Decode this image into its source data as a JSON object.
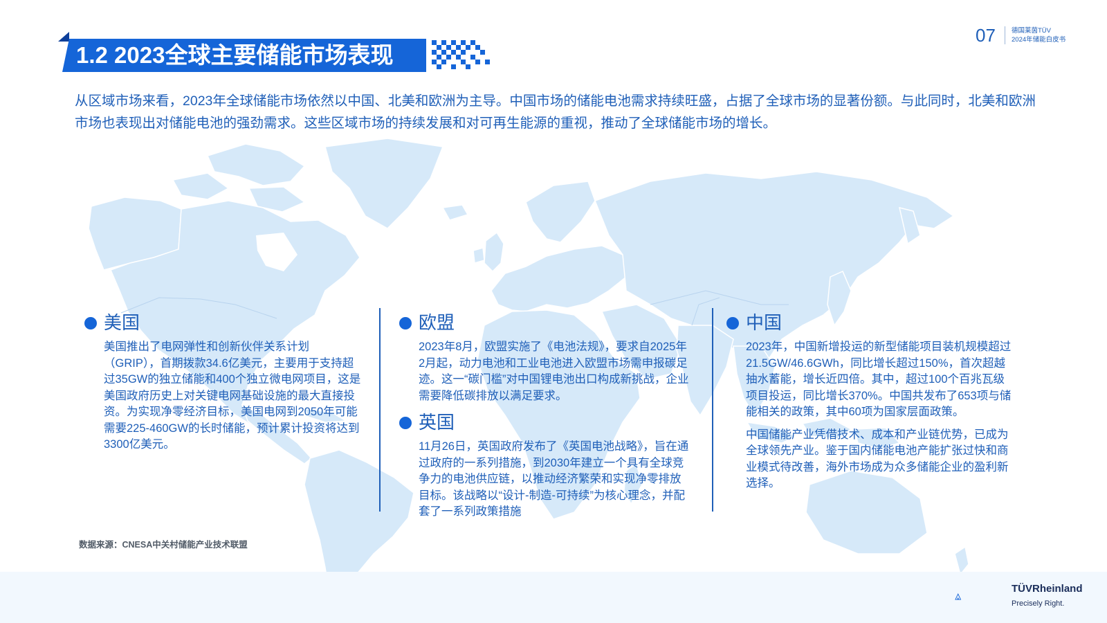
{
  "header": {
    "title": "1.2 2023全球主要储能市场表现",
    "page_number": "07",
    "brand_line1": "德国莱茵TÜV",
    "brand_line2": "2024年储能白皮书"
  },
  "intro": "从区域市场来看，2023年全球储能市场依然以中国、北美和欧洲为主导。中国市场的储能电池需求持续旺盛，占据了全球市场的显著份额。与此同时，北美和欧洲市场也表现出对储能电池的强劲需求。这些区域市场的持续发展和对可再生能源的重视，推动了全球储能市场的增长。",
  "sections": {
    "usa": {
      "title": "美国",
      "paragraphs": [
        "美国推出了电网弹性和创新伙伴关系计划（GRIP），首期拨款34.6亿美元，主要用于支持超过35GW的独立储能和400个独立微电网项目，这是美国政府历史上对关键电网基础设施的最大直接投资。为实现净零经济目标，美国电网到2050年可能需要225-460GW的长时储能，预计累计投资将达到3300亿美元。"
      ]
    },
    "eu": {
      "title": "欧盟",
      "paragraphs": [
        "2023年8月，欧盟实施了《电池法规》，要求自2025年2月起，动力电池和工业电池进入欧盟市场需申报碳足迹。这一“碳门槛”对中国锂电池出口构成新挑战，企业需要降低碳排放以满足要求。"
      ]
    },
    "uk": {
      "title": "英国",
      "paragraphs": [
        "11月26日，英国政府发布了《英国电池战略》，旨在通过政府的一系列措施，到2030年建立一个具有全球竞争力的电池供应链，以推动经济繁荣和实现净零排放目标。该战略以“设计-制造-可持续”为核心理念，并配套了一系列政策措施"
      ]
    },
    "china": {
      "title": "中国",
      "paragraphs": [
        "2023年，中国新增投运的新型储能项目装机规模超过21.5GW/46.6GWh，同比增长超过150%，首次超越抽水蓄能，增长近四倍。其中，超过100个百兆瓦级项目投运，同比增长370%。中国共发布了653项与储能相关的政策，其中60项为国家层面政策。",
        "中国储能产业凭借技术、成本和产业链优势，已成为全球领先产业。鉴于国内储能电池产能扩张过快和商业模式待改善，海外市场成为众多储能企业的盈利新选择。"
      ]
    }
  },
  "source": "数据来源：CNESA中关村储能产业技术联盟",
  "footer": {
    "company": "TÜVRheinland",
    "slogan": "Precisely Right."
  },
  "colors": {
    "primary": "#1565d8",
    "text": "#1f5fb8",
    "map_fill": "#d3e7f8",
    "map_stroke": "#ffffff"
  }
}
